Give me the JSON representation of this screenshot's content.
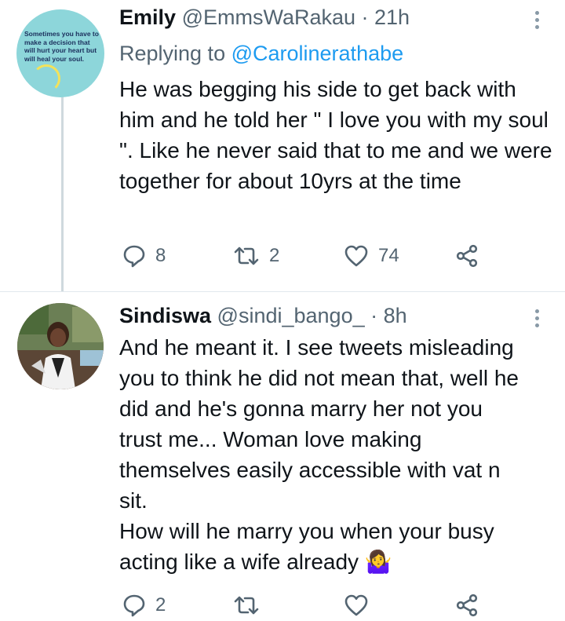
{
  "tweets": [
    {
      "name": "Emily",
      "handle": "@EmmsWaRakau",
      "time": "· 21h",
      "replying_prefix": "Replying to ",
      "replying_to": "@Carolinerathabe",
      "avatar_text": "Sometimes you have to make a decision that will hurt your heart but will heal your soul.",
      "body": "He was begging his side to get back with him and he told her \" I love you with my soul \". Like he never said that to me and we were together for about 10yrs at the time",
      "replies": "8",
      "retweets": "2",
      "likes": "74"
    },
    {
      "name": "Sindiswa",
      "handle": "@sindi_bango_",
      "time": "· 8h",
      "body_lines": [
        "And he meant it. I see tweets misleading",
        "you to think he did not mean that, well he",
        "did and he's gonna marry her not you",
        "trust me... Woman love making",
        "themselves easily accessible with vat n",
        "sit.",
        "How will he marry you when your busy",
        "acting like a wife already 🤷‍♀️"
      ],
      "replies": "2",
      "retweets": "",
      "likes": ""
    }
  ],
  "colors": {
    "text": "#0f1419",
    "secondary": "#536471",
    "link": "#1d9bf0",
    "divider": "#e1e8ed"
  },
  "icons": [
    "reply-icon",
    "retweet-icon",
    "like-icon",
    "share-icon",
    "more-icon"
  ]
}
